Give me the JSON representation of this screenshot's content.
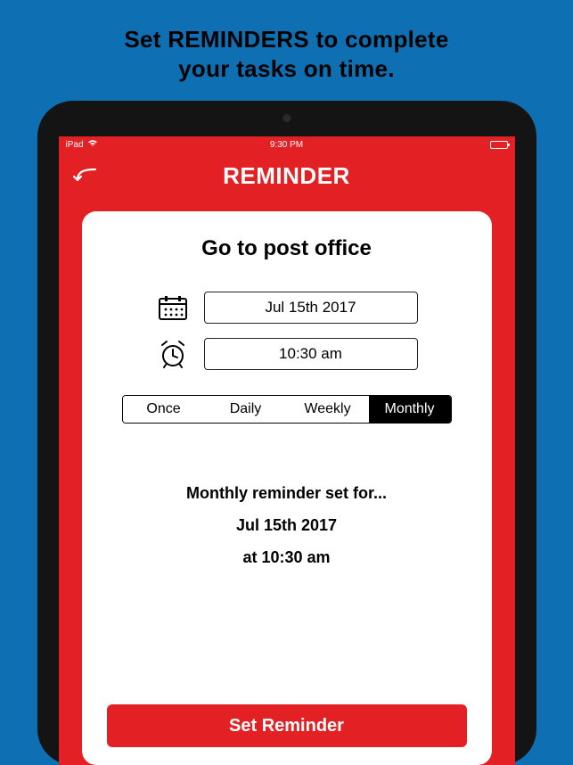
{
  "promo": {
    "headline_line1": "Set REMINDERS to complete",
    "headline_line2": "your tasks on time."
  },
  "status_bar": {
    "device": "iPad",
    "time": "9:30 PM"
  },
  "header": {
    "title": "REMINDER"
  },
  "reminder": {
    "task_title": "Go to post office",
    "date_value": "Jul 15th 2017",
    "time_value": "10:30 am",
    "frequency_options": [
      "Once",
      "Daily",
      "Weekly",
      "Monthly"
    ],
    "frequency_selected": "Monthly",
    "summary_line1": "Monthly reminder set for...",
    "summary_line2": "Jul 15th 2017",
    "summary_line3": "at 10:30 am",
    "set_button_label": "Set Reminder"
  },
  "icons": {
    "back": "back-arrow-icon",
    "calendar": "calendar-icon",
    "clock": "alarm-clock-icon",
    "wifi": "wifi-icon",
    "battery": "battery-icon"
  }
}
